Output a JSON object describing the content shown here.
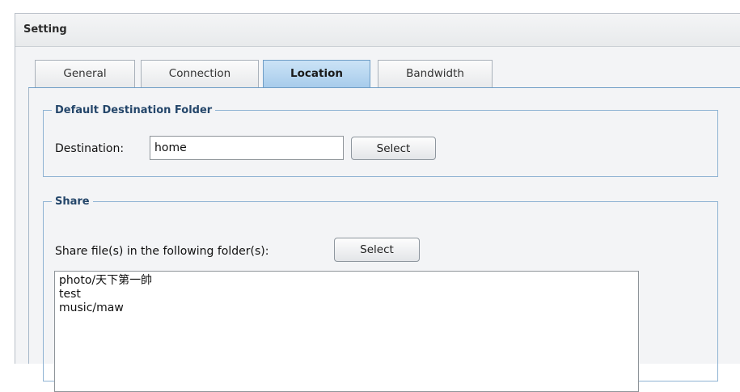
{
  "window": {
    "title": "Setting"
  },
  "tabs": [
    {
      "label": "General",
      "active": false
    },
    {
      "label": "Connection",
      "active": false
    },
    {
      "label": "Location",
      "active": true
    },
    {
      "label": "Bandwidth",
      "active": false
    }
  ],
  "default_destination": {
    "legend": "Default Destination Folder",
    "label": "Destination:",
    "value": "home",
    "select_label": "Select"
  },
  "share": {
    "legend": "Share",
    "label": "Share file(s) in the following folder(s):",
    "select_label": "Select",
    "folders": [
      "photo/天下第一帥",
      "test",
      "music/maw"
    ]
  },
  "colors": {
    "active_tab": "#b8d6f0",
    "fieldset_border": "#8fb3d3",
    "legend_text": "#24466a"
  }
}
